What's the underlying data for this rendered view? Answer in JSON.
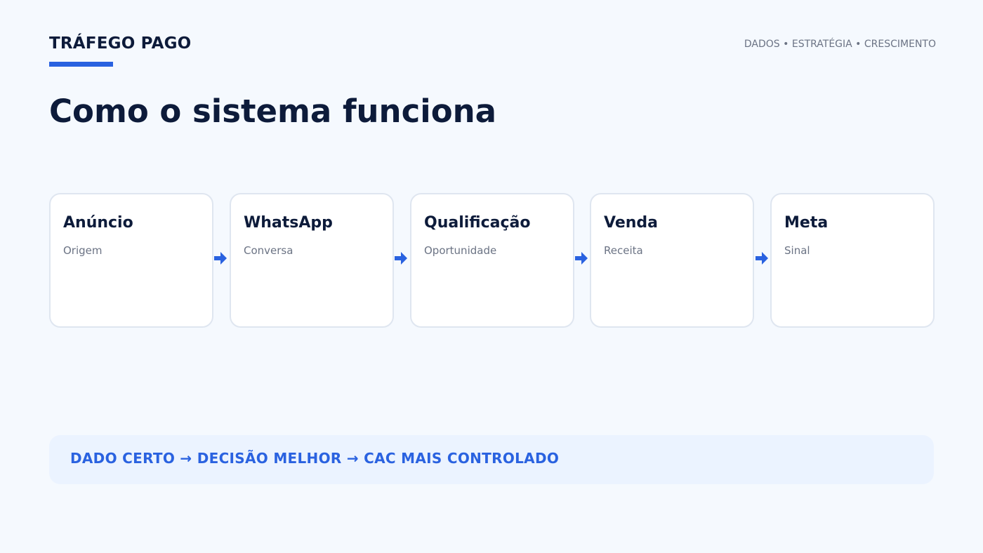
{
  "header": {
    "brand": "TRÁFEGO PAGO",
    "tagline": "DADOS • ESTRATÉGIA • CRESCIMENTO"
  },
  "page": {
    "title": "Como o sistema funciona"
  },
  "flow": {
    "steps": [
      {
        "title": "Anúncio",
        "subtitle": "Origem"
      },
      {
        "title": "WhatsApp",
        "subtitle": "Conversa"
      },
      {
        "title": "Qualificação",
        "subtitle": "Oportunidade"
      },
      {
        "title": "Venda",
        "subtitle": "Receita"
      },
      {
        "title": "Meta",
        "subtitle": "Sinal"
      }
    ]
  },
  "callout": {
    "text": "DADO CERTO → DECISÃO MELHOR → CAC MAIS CONTROLADO"
  },
  "colors": {
    "accent": "#2a62e0",
    "text_dark": "#0d1b3a",
    "text_muted": "#6b7384",
    "card_border": "#dfe6f0",
    "background": "#f5f9fe",
    "callout_bg": "#ebf3ff"
  }
}
